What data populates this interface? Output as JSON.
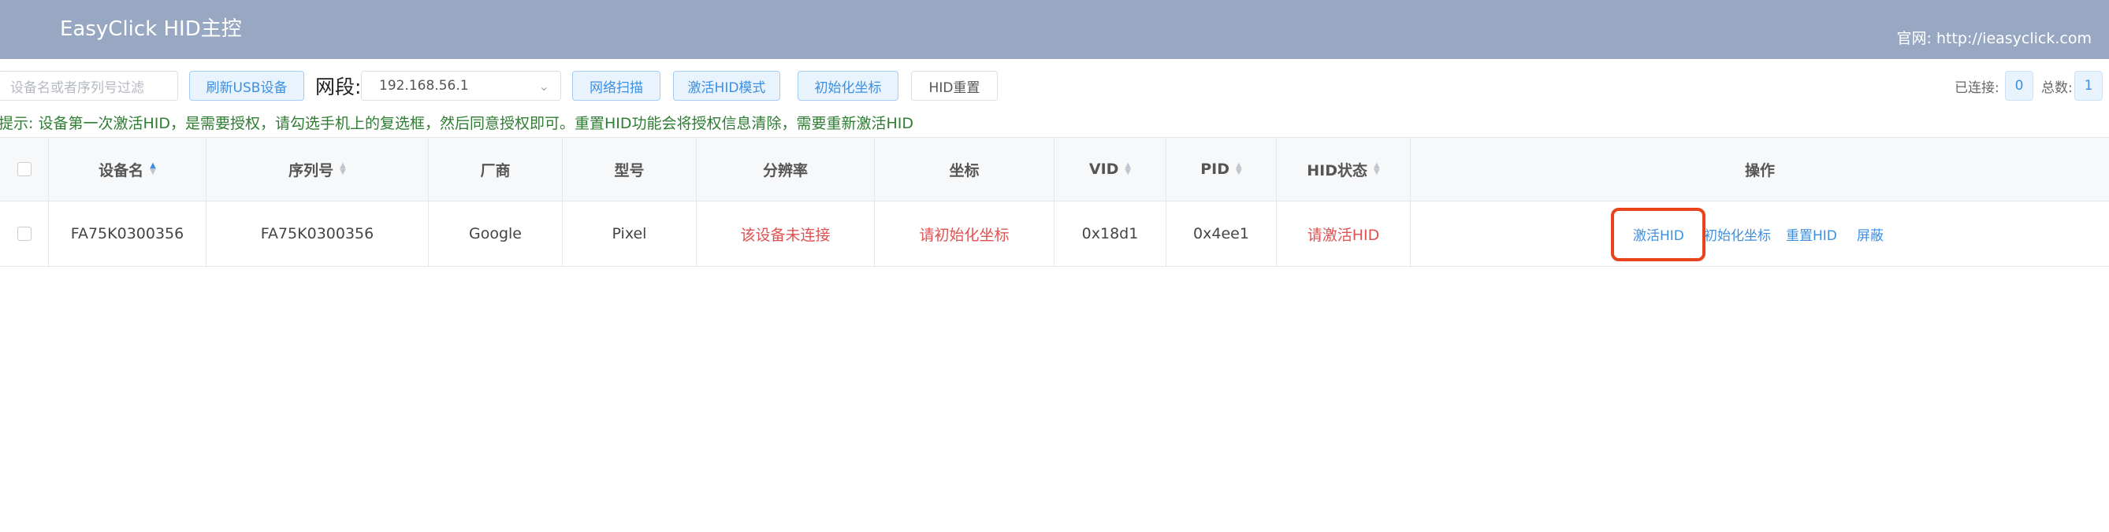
{
  "header": {
    "title": "EasyClick HID主控",
    "site": "官网: http://ieasyclick.com"
  },
  "toolbar": {
    "filter_placeholder": "设备名或者序列号过滤",
    "refresh_usb": "刷新USB设备",
    "segment_label": "网段:",
    "segment_value": "192.168.56.1",
    "network_scan": "网络扫描",
    "activate_hid_mode": "激活HID模式",
    "init_coords": "初始化坐标",
    "hid_reset": "HID重置",
    "connected_label": "已连接:",
    "connected_count": "0",
    "total_label": "总数:",
    "total_count": "1"
  },
  "hint": "提示: 设备第一次激活HID，是需要授权，请勾选手机上的复选框，然后同意授权即可。重置HID功能会将授权信息清除，需要重新激活HID",
  "table": {
    "columns": {
      "device_name": "设备名",
      "serial": "序列号",
      "vendor": "厂商",
      "model": "型号",
      "resolution": "分辨率",
      "coords": "坐标",
      "vid": "VID",
      "pid": "PID",
      "hid_status": "HID状态",
      "actions": "操作"
    },
    "rows": [
      {
        "device_name": "FA75K0300356",
        "serial": "FA75K0300356",
        "vendor": "Google",
        "model": "Pixel",
        "resolution": "该设备未连接",
        "coords": "请初始化坐标",
        "vid": "0x18d1",
        "pid": "0x4ee1",
        "hid_status": "请激活HID",
        "actions": {
          "activate": "激活HID",
          "init": "初始化坐标",
          "reset": "重置HID",
          "block": "屏蔽"
        }
      }
    ]
  },
  "colors": {
    "header_bg": "#98a8c2",
    "accent": "#3d8fe0",
    "warning_red": "#e05252",
    "highlight_border": "#e8431b",
    "hint_green": "#2e7d32"
  }
}
